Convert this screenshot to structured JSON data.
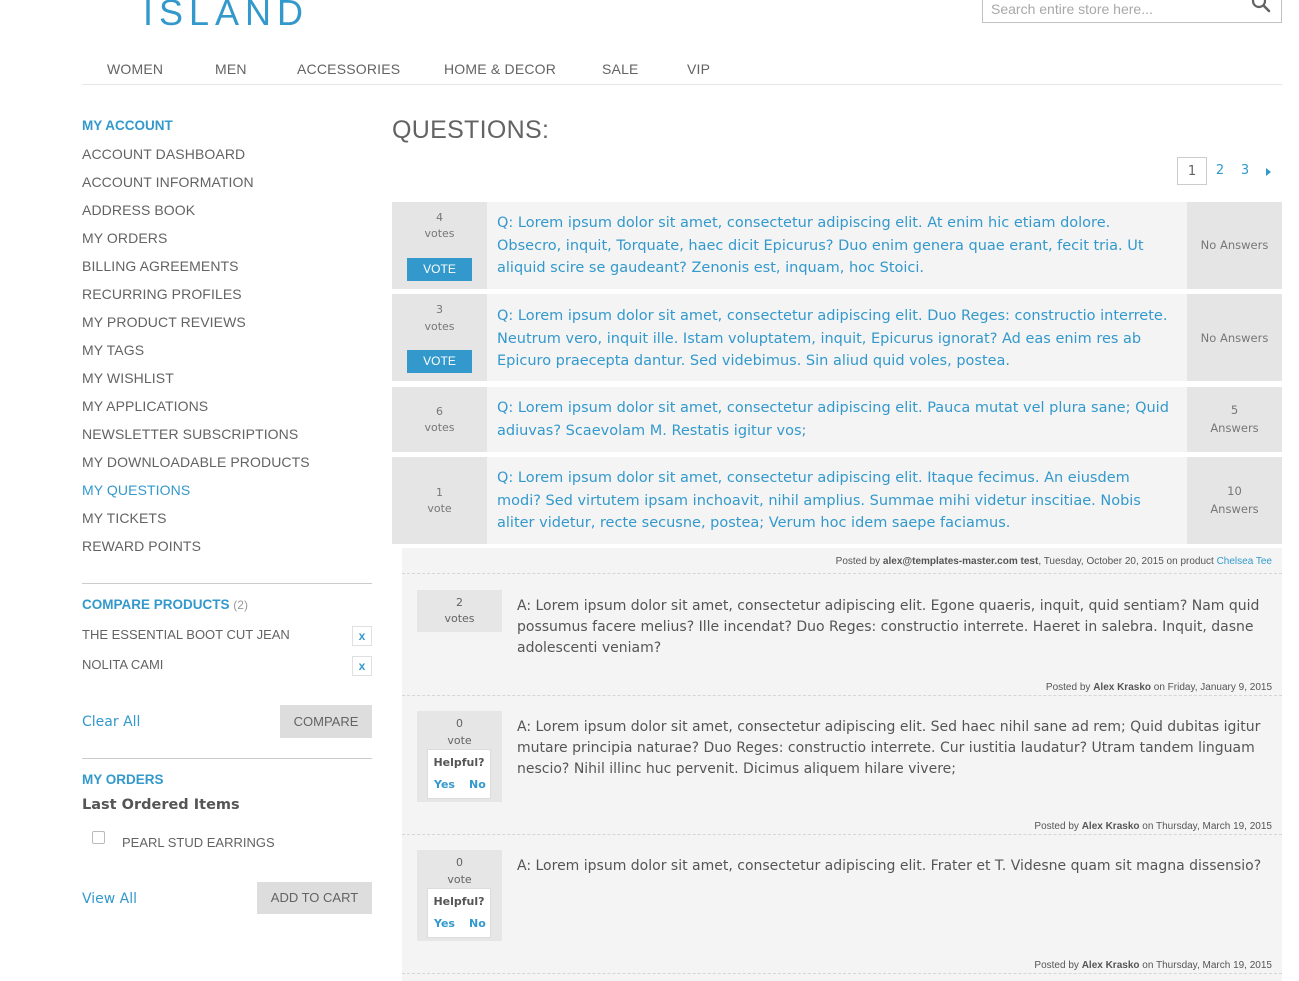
{
  "header": {
    "logo": "ISLAND",
    "search_placeholder": "Search entire store here...",
    "search_icon": "search-icon",
    "nav": [
      "WOMEN",
      "MEN",
      "ACCESSORIES",
      "HOME & DECOR",
      "SALE",
      "VIP"
    ]
  },
  "sidebar": {
    "account_title": "MY ACCOUNT",
    "items": [
      "ACCOUNT DASHBOARD",
      "ACCOUNT INFORMATION",
      "ADDRESS BOOK",
      "MY ORDERS",
      "BILLING AGREEMENTS",
      "RECURRING PROFILES",
      "MY PRODUCT REVIEWS",
      "MY TAGS",
      "MY WISHLIST",
      "MY APPLICATIONS",
      "NEWSLETTER SUBSCRIPTIONS",
      "MY DOWNLOADABLE PRODUCTS",
      "MY QUESTIONS",
      "MY TICKETS",
      "REWARD POINTS"
    ],
    "active_item": "MY QUESTIONS",
    "compare": {
      "title": "COMPARE PRODUCTS",
      "count": "(2)",
      "products": [
        "THE ESSENTIAL BOOT CUT JEAN",
        "NOLITA CAMI"
      ],
      "remove_label": "x",
      "clear_all": "Clear All",
      "compare_button": "COMPARE"
    },
    "orders": {
      "title": "MY ORDERS",
      "subtitle": "Last Ordered Items",
      "items": [
        "PEARL STUD EARRINGS"
      ],
      "view_all": "View All",
      "add_to_cart": "ADD TO CART"
    }
  },
  "main": {
    "title": "QUESTIONS:",
    "pagination": {
      "pages": [
        "1",
        "2",
        "3"
      ],
      "current": "1",
      "next_icon": "next-arrow-icon"
    },
    "questions": [
      {
        "votes": "4",
        "votes_label": "votes",
        "vote_button": "VOTE",
        "text": "Q: Lorem ipsum dolor sit amet, consectetur adipiscing elit. At enim hic etiam dolore. Obsecro, inquit, Torquate, haec dicit Epicurus? Duo enim genera quae erant, fecit tria. Ut aliquid scire se gaudeant? Zenonis est, inquam, hoc Stoici.",
        "answers_line1": "No Answers",
        "answers_line2": ""
      },
      {
        "votes": "3",
        "votes_label": "votes",
        "vote_button": "VOTE",
        "text": "Q: Lorem ipsum dolor sit amet, consectetur adipiscing elit. Duo Reges: constructio interrete. Neutrum vero, inquit ille. Istam voluptatem, inquit, Epicurus ignorat? Ad eas enim res ab Epicuro praecepta dantur. Sed videbimus. Sin aliud quid voles, postea.",
        "answers_line1": "No Answers",
        "answers_line2": ""
      },
      {
        "votes": "6",
        "votes_label": "votes",
        "vote_button": "",
        "text": "Q: Lorem ipsum dolor sit amet, consectetur adipiscing elit. Pauca mutat vel plura sane; Quid adiuvas? Scaevolam M. Restatis igitur vos;",
        "answers_line1": "5",
        "answers_line2": "Answers"
      },
      {
        "votes": "1",
        "votes_label": "vote",
        "vote_button": "",
        "text": "Q: Lorem ipsum dolor sit amet, consectetur adipiscing elit. Itaque fecimus. An eiusdem modi? Sed virtutem ipsam inchoavit, nihil amplius. Summae mihi videtur inscitiae. Nobis aliter videtur, recte secusne, postea; Verum hoc idem saepe faciamus.",
        "answers_line1": "10",
        "answers_line2": "Answers"
      }
    ],
    "question_meta": {
      "prefix": "Posted by",
      "author": "alex@templates-master.com test",
      "date": ", Tuesday, October 20, 2015 on product",
      "product": "Chelsea Tee"
    },
    "answers": [
      {
        "votes": "2",
        "votes_label": "votes",
        "helpful": false,
        "text": "A: Lorem ipsum dolor sit amet, consectetur adipiscing elit. Egone quaeris, inquit, quid sentiam? Nam quid possumus facere melius? Ille incendat? Duo Reges: constructio interrete. Haeret in salebra. Inquit, dasne adolescenti veniam?",
        "posted_prefix": "Posted by",
        "author": "Alex Krasko",
        "date": "on Friday, January 9, 2015"
      },
      {
        "votes": "0",
        "votes_label": "vote",
        "helpful": true,
        "text": "A: Lorem ipsum dolor sit amet, consectetur adipiscing elit. Sed haec nihil sane ad rem; Quid dubitas igitur mutare principia naturae? Duo Reges: constructio interrete. Cur iustitia laudatur? Utram tandem linguam nescio? Nihil illinc huc pervenit. Dicimus aliquem hilare vivere;",
        "posted_prefix": "Posted by",
        "author": "Alex Krasko",
        "date": "on Thursday, March 19, 2015"
      },
      {
        "votes": "0",
        "votes_label": "vote",
        "helpful": true,
        "text": "A: Lorem ipsum dolor sit amet, consectetur adipiscing elit. Frater et T. Videsne quam sit magna dissensio?",
        "posted_prefix": "Posted by",
        "author": "Alex Krasko",
        "date": "on Thursday, March 19, 2015"
      }
    ],
    "helpful": {
      "label": "Helpful?",
      "yes": "Yes",
      "no": "No"
    }
  },
  "colors": {
    "accent": "#3399cc",
    "text": "#636363",
    "panel": "#f4f4f4",
    "vote_bg": "#e5e5e5"
  }
}
